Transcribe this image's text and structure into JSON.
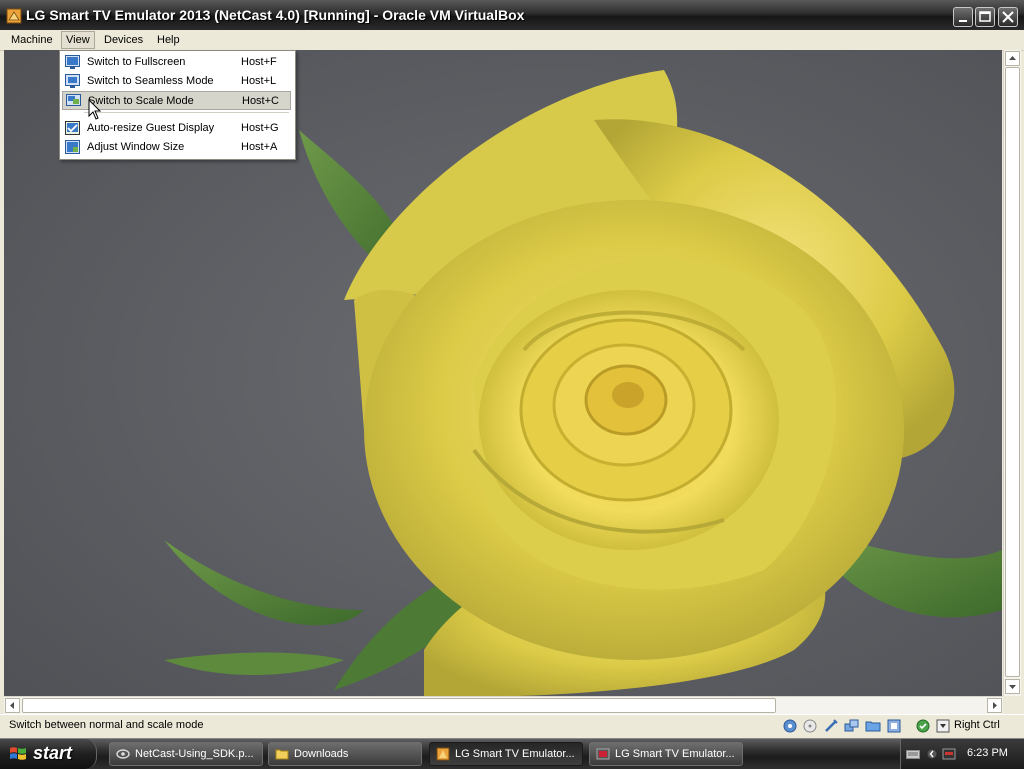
{
  "window": {
    "title": "LG Smart TV Emulator 2013 (NetCast 4.0) [Running] - Oracle VM VirtualBox",
    "controls": [
      "minimize",
      "maximize",
      "close"
    ]
  },
  "menubar": {
    "items": [
      "Machine",
      "View",
      "Devices",
      "Help"
    ]
  },
  "view_menu": {
    "items": [
      {
        "label": "Switch to Fullscreen",
        "shortcut": "Host+F",
        "icon": "fullscreen-icon"
      },
      {
        "label": "Switch to Seamless Mode",
        "shortcut": "Host+L",
        "icon": "seamless-icon"
      },
      {
        "label": "Switch to Scale Mode",
        "shortcut": "Host+C",
        "icon": "scale-mode-icon",
        "highlighted": true
      },
      {
        "label": "Auto-resize Guest Display",
        "shortcut": "Host+G",
        "icon": "auto-resize-icon",
        "checked": true
      },
      {
        "label": "Adjust Window Size",
        "shortcut": "Host+A",
        "icon": "adjust-window-icon"
      }
    ]
  },
  "guest": {
    "content": "yellow-rose-image"
  },
  "statusbar": {
    "text": "Switch between normal and scale mode",
    "host_key": "Right Ctrl",
    "icons": [
      "hard-disk-icon",
      "optical-drive-icon",
      "usb-icon",
      "network-icon",
      "shared-folders-icon",
      "video-capture-icon",
      "virtualization-icon",
      "host-key-icon"
    ]
  },
  "taskbar": {
    "start_label": "start",
    "tasks": [
      {
        "label": "NetCast-Using_SDK.p...",
        "icon": "pdf-icon",
        "active": false
      },
      {
        "label": "Downloads",
        "icon": "folder-icon",
        "active": false
      },
      {
        "label": "LG Smart TV Emulator...",
        "icon": "virtualbox-icon",
        "active": true
      },
      {
        "label": "LG Smart TV Emulator...",
        "icon": "virtualbox-icon",
        "active": false
      }
    ],
    "clock": "6:23 PM"
  },
  "colors": {
    "titlebar": "#2d2d2d",
    "menu_highlight": "#d6d5cc",
    "guest_background": "#5a5c60",
    "rose_yellow": "#d8cc44"
  }
}
